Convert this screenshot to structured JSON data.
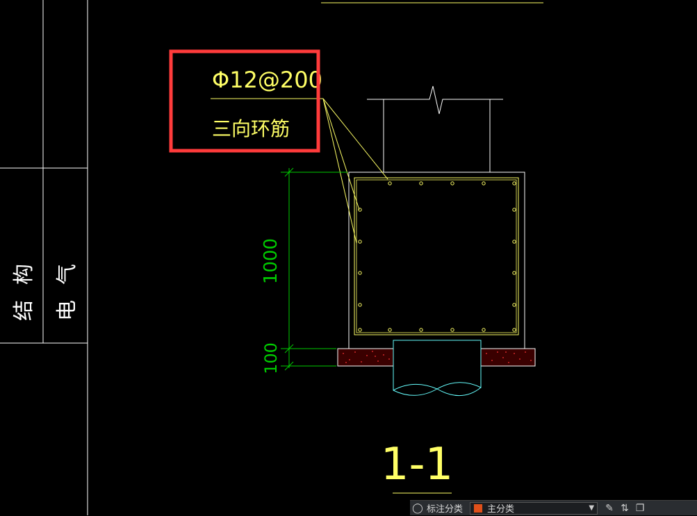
{
  "title_block": {
    "structure_label": "结构",
    "electrical_label": "电气"
  },
  "callout": {
    "rebar_spec": "Φ12@200",
    "rebar_desc": "三向环筋"
  },
  "dimensions": {
    "height_main": "1000",
    "height_base": "100"
  },
  "section_label": "1-1",
  "colors": {
    "background": "#000000",
    "lines_white": "#ffffff",
    "annotation_yellow": "#ffff66",
    "dimension_green": "#00cc00",
    "pile_cyan": "#66ffff",
    "highlight_red": "#ff3b3b",
    "cushion_red": "#8b0000"
  },
  "status_bar": {
    "annotation_scale_label": "标注分类",
    "layer_select_value": "主分类",
    "layer_color": "#e0501a"
  }
}
